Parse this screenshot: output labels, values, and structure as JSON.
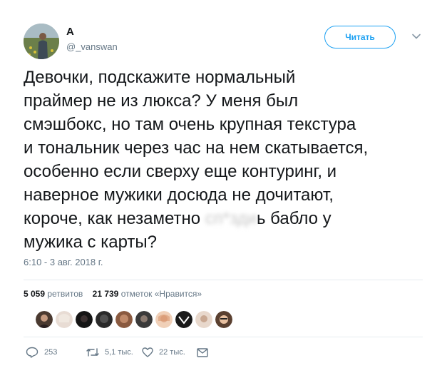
{
  "user": {
    "name": "A",
    "handle": "@_vanswan",
    "avatar_icon": "profile-photo-avatar"
  },
  "follow_button": {
    "label": "Читать"
  },
  "more_menu": {
    "icon": "chevron-down-icon"
  },
  "tweet": {
    "text_before": "Девочки, подскажите нормальный\nпраймер не из люкса? У меня был\nсмэшбокс,  но там очень крупная текстура\nи тональник через час на нем скатывается,\nособенно если сверху еще контуринг, и\nнаверное мужики досюда не  дочитают,\nкороче, как незаметно ",
    "text_after": "ь бабло у\nмужика с карты?",
    "timestamp": "6:10 - 3 авг. 2018 г."
  },
  "stats": {
    "retweets_count": "5 059",
    "retweets_label": "ретвитов",
    "likes_count": "21 739",
    "likes_label": "отметок «Нравится»"
  },
  "likers": [
    {
      "color": "#4a3a30"
    },
    {
      "color": "#d8c8c0"
    },
    {
      "color": "#1a1a1a"
    },
    {
      "color": "#2a2a2a"
    },
    {
      "color": "#b07a5a"
    },
    {
      "color": "#3a3a3a"
    },
    {
      "color": "#e0b090"
    },
    {
      "color": "#202020"
    },
    {
      "color": "#c9a892"
    },
    {
      "color": "#5a4030"
    }
  ],
  "actions": {
    "reply_count": "253",
    "retweet_count": "5,1 тыс.",
    "like_count": "22 тыс."
  },
  "colors": {
    "accent": "#1da1f2",
    "text": "#14171a",
    "secondary": "#657786",
    "divider": "#e6ecf0"
  }
}
